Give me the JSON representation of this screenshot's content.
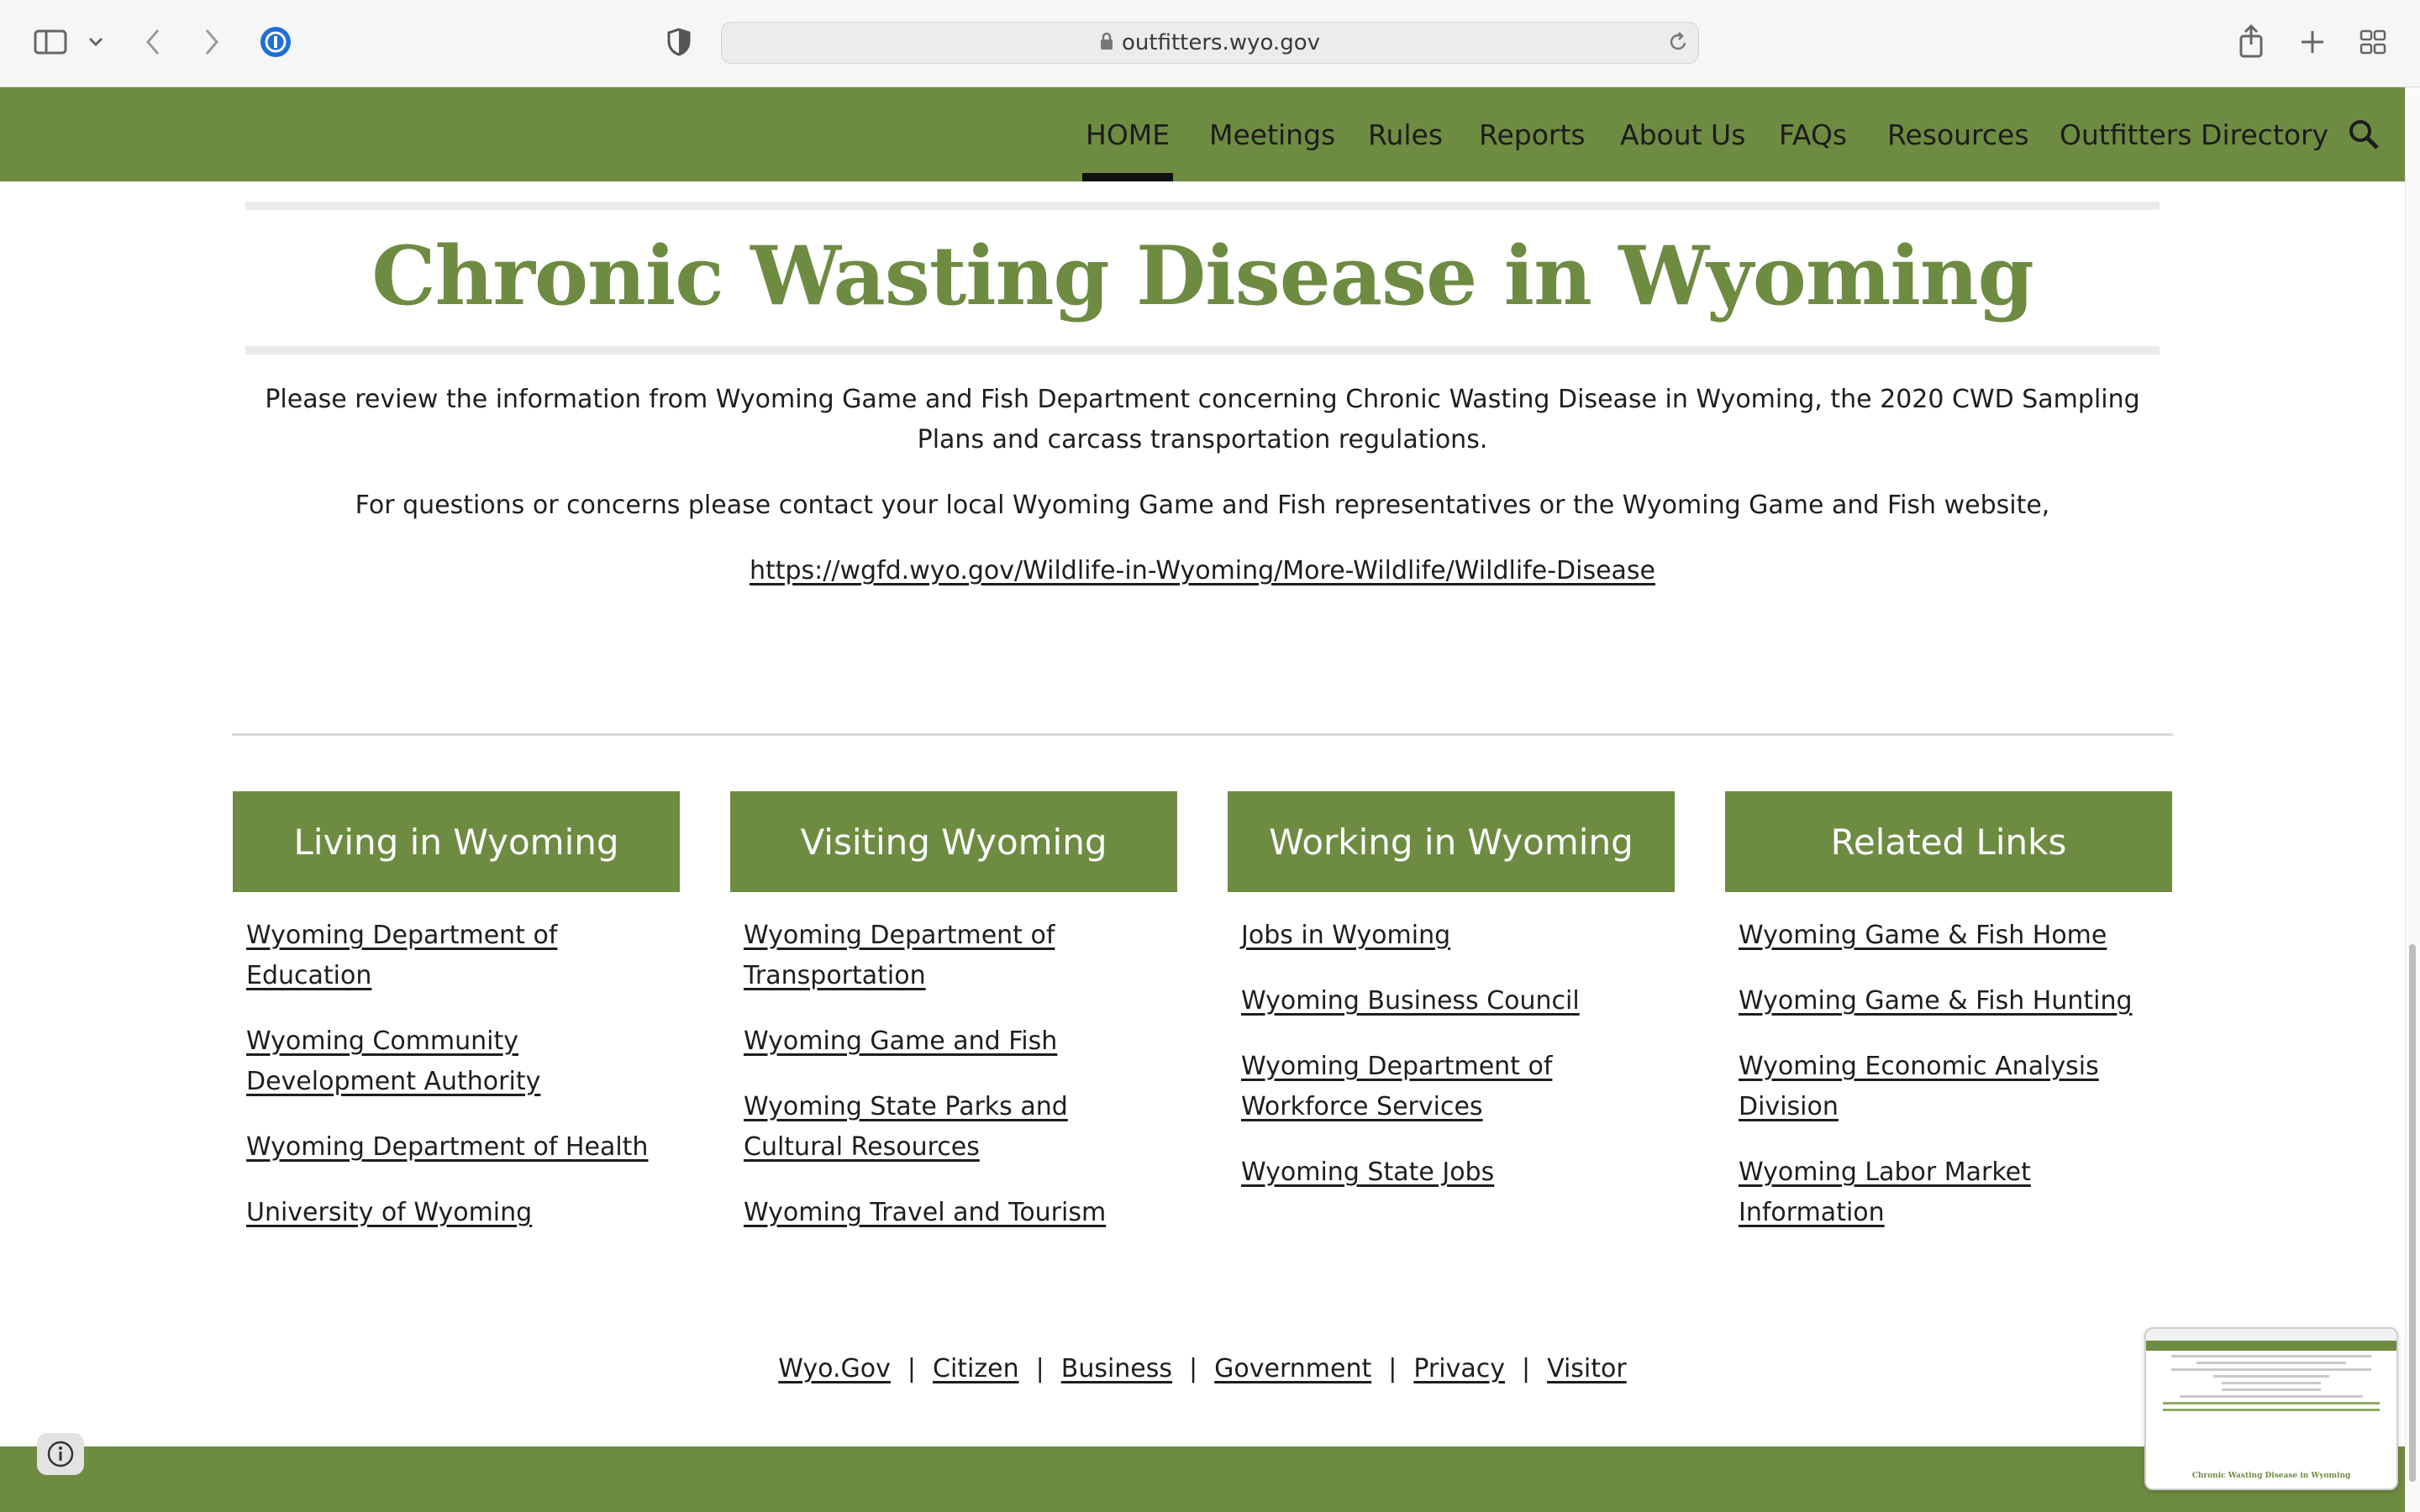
{
  "browser": {
    "url": "outfitters.wyo.gov",
    "icons": [
      "sidebar-icon",
      "chevron-down-icon",
      "back-icon",
      "forward-icon",
      "password-manager-icon",
      "shield-icon",
      "lock-icon",
      "reload-icon",
      "share-icon",
      "new-tab-icon",
      "tab-overview-icon"
    ]
  },
  "nav": {
    "items": [
      {
        "label": "HOME",
        "active": true
      },
      {
        "label": "Meetings"
      },
      {
        "label": "Rules"
      },
      {
        "label": "Reports"
      },
      {
        "label": "About Us"
      },
      {
        "label": "FAQs"
      },
      {
        "label": "Resources"
      },
      {
        "label": "Outfitters Directory"
      }
    ],
    "search_icon": "search-icon"
  },
  "main": {
    "title": "Chronic Wasting Disease in Wyoming",
    "paragraph1": "Please review the information from Wyoming Game and Fish Department concerning Chronic Wasting Disease in Wyoming, the 2020 CWD Sampling Plans and carcass transportation regulations.",
    "paragraph2": "For questions or concerns please contact your local Wyoming Game and Fish representatives or the Wyoming Game and Fish website,",
    "link": "https://wgfd.wyo.gov/Wildlife-in-Wyoming/More-Wildlife/Wildlife-Disease"
  },
  "footer": {
    "columns": [
      {
        "title": "Living in Wyoming",
        "links": [
          "Wyoming Department of Education",
          "Wyoming Community Development Authority",
          "Wyoming Department of Health",
          "University of Wyoming"
        ]
      },
      {
        "title": "Visiting Wyoming",
        "links": [
          "Wyoming Department of Transportation",
          "Wyoming Game and Fish",
          "Wyoming State Parks and Cultural Resources",
          "Wyoming Travel and Tourism"
        ]
      },
      {
        "title": "Working in Wyoming",
        "links": [
          "Jobs in Wyoming",
          "Wyoming Business Council",
          "Wyoming Department of Workforce Services",
          "Wyoming State Jobs"
        ]
      },
      {
        "title": "Related Links",
        "links": [
          "Wyoming Game & Fish Home",
          "Wyoming Game & Fish Hunting",
          "Wyoming Economic Analysis Division",
          "Wyoming Labor Market Information"
        ]
      }
    ],
    "bottom_links": [
      "Wyo.Gov",
      "Citizen",
      "Business",
      "Government",
      "Privacy",
      "Visitor"
    ],
    "separator": "|"
  },
  "colors": {
    "brand_green": "#6e8b42",
    "text": "#1e1e1e",
    "chrome_bg": "#f6f6f6"
  }
}
